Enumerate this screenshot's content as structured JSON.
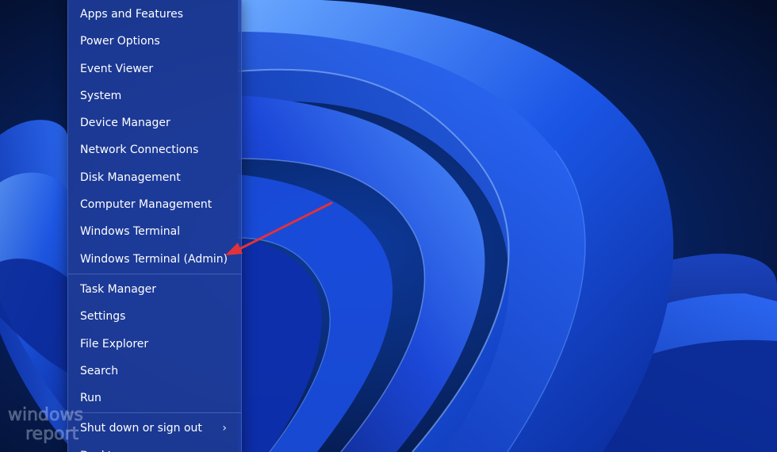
{
  "menu": {
    "groups": [
      [
        "Apps and Features",
        "Power Options",
        "Event Viewer",
        "System",
        "Device Manager",
        "Network Connections",
        "Disk Management",
        "Computer Management",
        "Windows Terminal",
        "Windows Terminal (Admin)"
      ],
      [
        "Task Manager",
        "Settings",
        "File Explorer",
        "Search",
        "Run"
      ],
      [
        "Shut down or sign out",
        "Desktop"
      ]
    ],
    "submenu_indicator": "›"
  },
  "watermark": {
    "line1": "windows",
    "line2": "report"
  },
  "colors": {
    "menu_background": "#203e9e",
    "menu_text": "#ffffff",
    "arrow": "#e2323a"
  },
  "icons": {
    "submenu": "chevron-right-icon",
    "annotation": "red-arrow-icon"
  }
}
